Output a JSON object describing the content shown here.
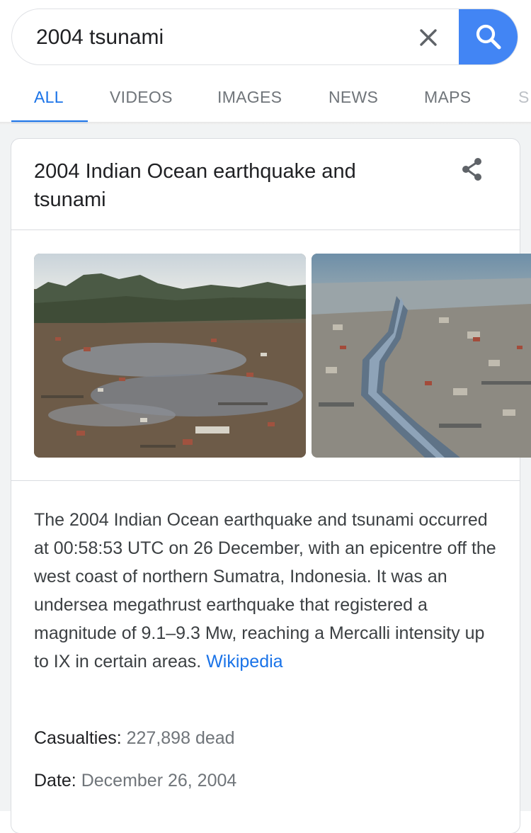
{
  "search": {
    "query": "2004 tsunami"
  },
  "tabs": [
    {
      "label": "ALL",
      "active": true
    },
    {
      "label": "VIDEOS"
    },
    {
      "label": "IMAGES"
    },
    {
      "label": "NEWS"
    },
    {
      "label": "MAPS"
    },
    {
      "label": "S"
    }
  ],
  "knowledge_panel": {
    "title": "2004 Indian Ocean earthquake and tsunami",
    "share_icon": "share-icon",
    "images": [
      {
        "subject": "aerial view of flooded devastated town with mountains"
      },
      {
        "subject": "aerial view of canal through destroyed coastal town"
      }
    ],
    "description": "The 2004 Indian Ocean earthquake and tsunami occurred at 00:58:53 UTC on 26 December, with an epicentre off the west coast of northern Sumatra, Indonesia. It was an undersea megathrust earthquake that registered a magnitude of 9.1–9.3 Mw, reaching a Mercalli intensity up to IX in certain areas.",
    "source_link": "Wikipedia",
    "facts": [
      {
        "label": "Casualties:",
        "value": "227,898 dead"
      },
      {
        "label": "Date:",
        "value": "December 26, 2004"
      }
    ]
  },
  "colors": {
    "accent": "#1a73e8",
    "search_button": "#4285f4",
    "text_primary": "#202124",
    "text_secondary": "#70757a"
  }
}
